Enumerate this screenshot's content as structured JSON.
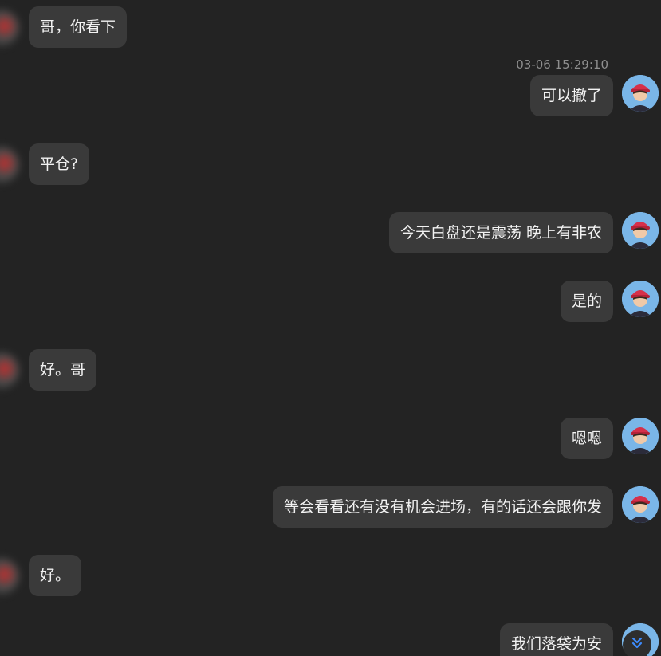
{
  "timestamp": "03-06 15:29:10",
  "messages": [
    {
      "id": "m1",
      "side": "in",
      "text": "哥，你看下"
    },
    {
      "id": "m2",
      "side": "out",
      "text": "可以撤了"
    },
    {
      "id": "m3",
      "side": "in",
      "text": "平仓?"
    },
    {
      "id": "m4",
      "side": "out",
      "text": "今天白盘还是震荡 晚上有非农"
    },
    {
      "id": "m5",
      "side": "out",
      "text": "是的"
    },
    {
      "id": "m6",
      "side": "in",
      "text": "好。哥"
    },
    {
      "id": "m7",
      "side": "out",
      "text": "嗯嗯"
    },
    {
      "id": "m8",
      "side": "out",
      "text": "等会看看还有没有机会进场，有的话还会跟你发"
    },
    {
      "id": "m9",
      "side": "in",
      "text": "好。"
    },
    {
      "id": "m10",
      "side": "out",
      "text": "我们落袋为安"
    }
  ],
  "colors": {
    "background": "#232323",
    "bubble": "#3a3a3a",
    "text": "#f2f2f2",
    "timestamp": "#8e8e8e",
    "accent": "#3d8bfd"
  },
  "icons": {
    "scroll_down": "double-chevron-down-icon"
  }
}
